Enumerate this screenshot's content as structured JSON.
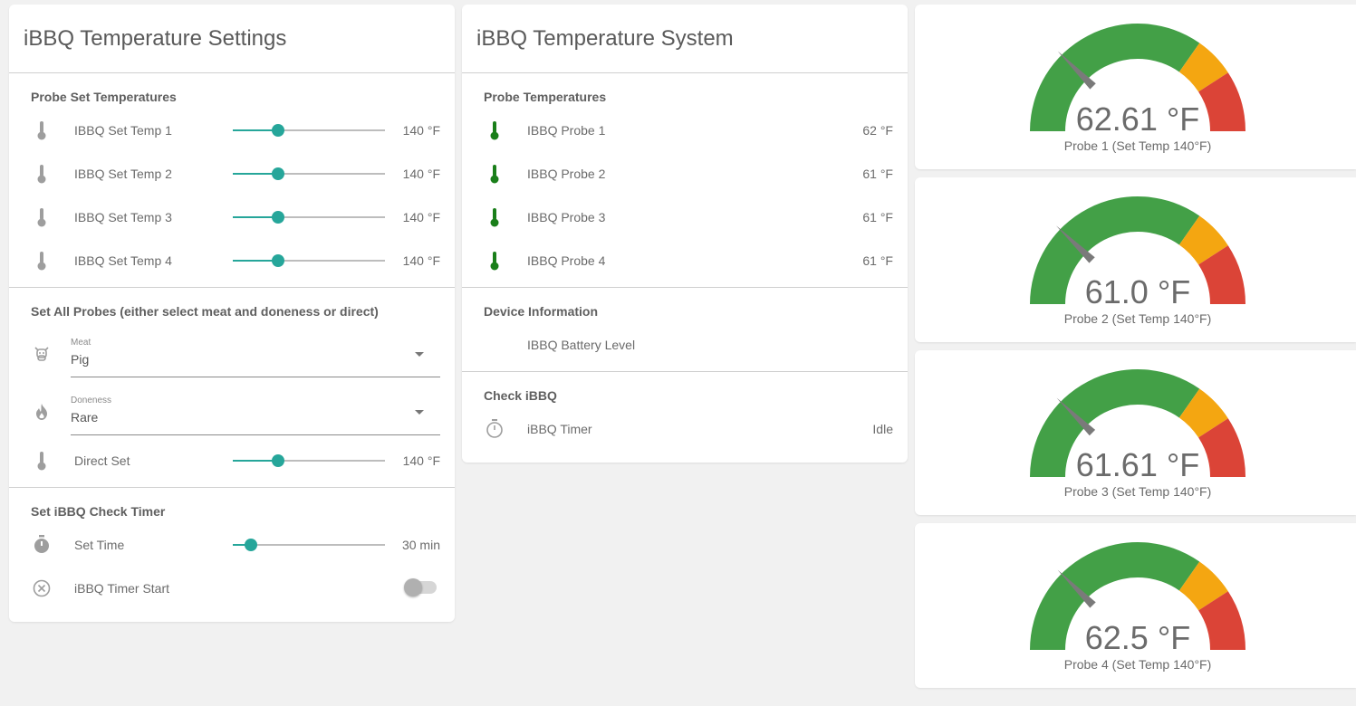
{
  "settings": {
    "title": "iBBQ Temperature Settings",
    "probe_set_header": "Probe Set Temperatures",
    "set_temps": [
      {
        "label": "IBBQ Set Temp 1",
        "value": "140 °F",
        "level": 0.3
      },
      {
        "label": "IBBQ Set Temp 2",
        "value": "140 °F",
        "level": 0.3
      },
      {
        "label": "IBBQ Set Temp 3",
        "value": "140 °F",
        "level": 0.3
      },
      {
        "label": "IBBQ Set Temp 4",
        "value": "140 °F",
        "level": 0.3
      }
    ],
    "all_probes_header": "Set All Probes (either select meat and doneness or direct)",
    "meat": {
      "label": "Meat",
      "value": "Pig"
    },
    "doneness": {
      "label": "Doneness",
      "value": "Rare"
    },
    "direct_set": {
      "label": "Direct Set",
      "value": "140 °F",
      "level": 0.3
    },
    "timer_header": "Set iBBQ Check Timer",
    "set_time": {
      "label": "Set Time",
      "value": "30 min",
      "level": 0.12
    },
    "timer_start": {
      "label": "iBBQ Timer Start",
      "state": "off"
    }
  },
  "system": {
    "title": "iBBQ Temperature System",
    "probe_temps_header": "Probe Temperatures",
    "probes": [
      {
        "label": "IBBQ Probe 1",
        "value": "62 °F"
      },
      {
        "label": "IBBQ Probe 2",
        "value": "61 °F"
      },
      {
        "label": "IBBQ Probe 3",
        "value": "61 °F"
      },
      {
        "label": "IBBQ Probe 4",
        "value": "61 °F"
      }
    ],
    "device_header": "Device Information",
    "battery_label": "IBBQ Battery Level",
    "check_header": "Check iBBQ",
    "timer_label": "iBBQ Timer",
    "timer_value": "Idle"
  },
  "gauges": [
    {
      "value_text": "62.61 °F",
      "value": 62.61,
      "name": "Probe 1 (Set Temp 140°F)"
    },
    {
      "value_text": "61.0 °F",
      "value": 61.0,
      "name": "Probe 2 (Set Temp 140°F)"
    },
    {
      "value_text": "61.61 °F",
      "value": 61.61,
      "name": "Probe 3 (Set Temp 140°F)"
    },
    {
      "value_text": "62.5 °F",
      "value": 62.5,
      "name": "Probe 4 (Set Temp 140°F)"
    }
  ],
  "colors": {
    "accent": "#26a69a",
    "probe_ok": "#1a7f1a",
    "gauge_green": "#43a047",
    "gauge_yellow": "#f4a611",
    "gauge_red": "#db4437",
    "needle": "#7a7a7a",
    "icon_grey": "#9e9e9e"
  },
  "icons": {
    "set_temp": "thermometer-icon",
    "probe": "thermometer-icon",
    "meat": "cow-icon",
    "doneness": "fire-icon",
    "direct_set": "thermometer-icon",
    "set_time": "timer-icon",
    "timer_start": "close-circle-icon",
    "check_timer": "timer-outline-icon"
  }
}
